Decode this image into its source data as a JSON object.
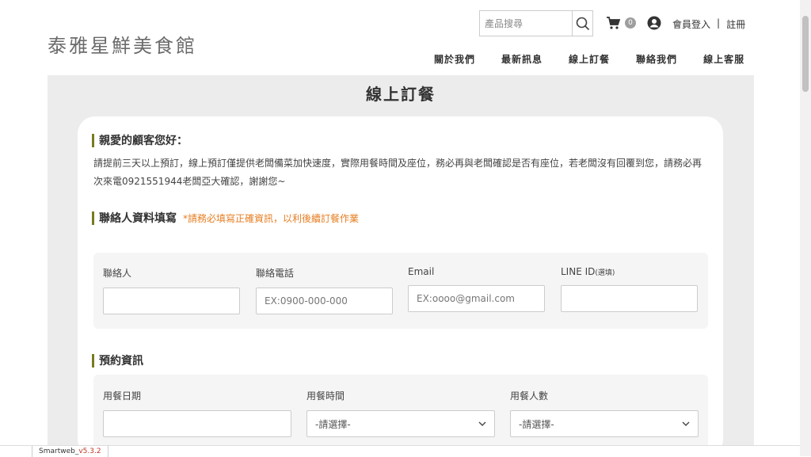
{
  "header": {
    "logo": "泰雅星鮮美食館",
    "search_placeholder": "產品搜尋",
    "cart_count": "0",
    "login": "會員登入",
    "divider": "|",
    "register": "註冊",
    "nav": [
      "關於我們",
      "最新訊息",
      "線上訂餐",
      "聯絡我們",
      "線上客服"
    ]
  },
  "page": {
    "title": "線上訂餐",
    "greeting_title": "親愛的顧客您好：",
    "greeting_text": "請提前三天以上預訂，線上預訂僅提供老闆備菜加快速度，實際用餐時間及座位，務必再與老闆確認是否有座位，若老闆沒有回覆到您，請務必再次來電0921551944老闆亞大確認，謝謝您~",
    "contact_title": "聯絡人資料填寫",
    "contact_hint": "*請務必填寫正確資訊，以利後續訂餐作業",
    "contact_fields": {
      "name_label": "聯絡人",
      "phone_label": "聯絡電話",
      "phone_placeholder": "EX:0900-000-000",
      "email_label": "Email",
      "email_placeholder": "EX:oooo@gmail.com",
      "line_label": "LINE ID",
      "line_optional": "(選填)"
    },
    "reserve_title": "預約資訊",
    "reserve_fields": {
      "date_label": "用餐日期",
      "time_label": "用餐時間",
      "time_value": "-請選擇-",
      "people_label": "用餐人數",
      "people_value": "-請選擇-"
    }
  },
  "footer": {
    "version_prefix": "Smartweb_",
    "version": "v5.3.2"
  },
  "colors": {
    "accent_bar": "#7a7a20",
    "hint": "#e67e22",
    "band": "#ececec"
  }
}
